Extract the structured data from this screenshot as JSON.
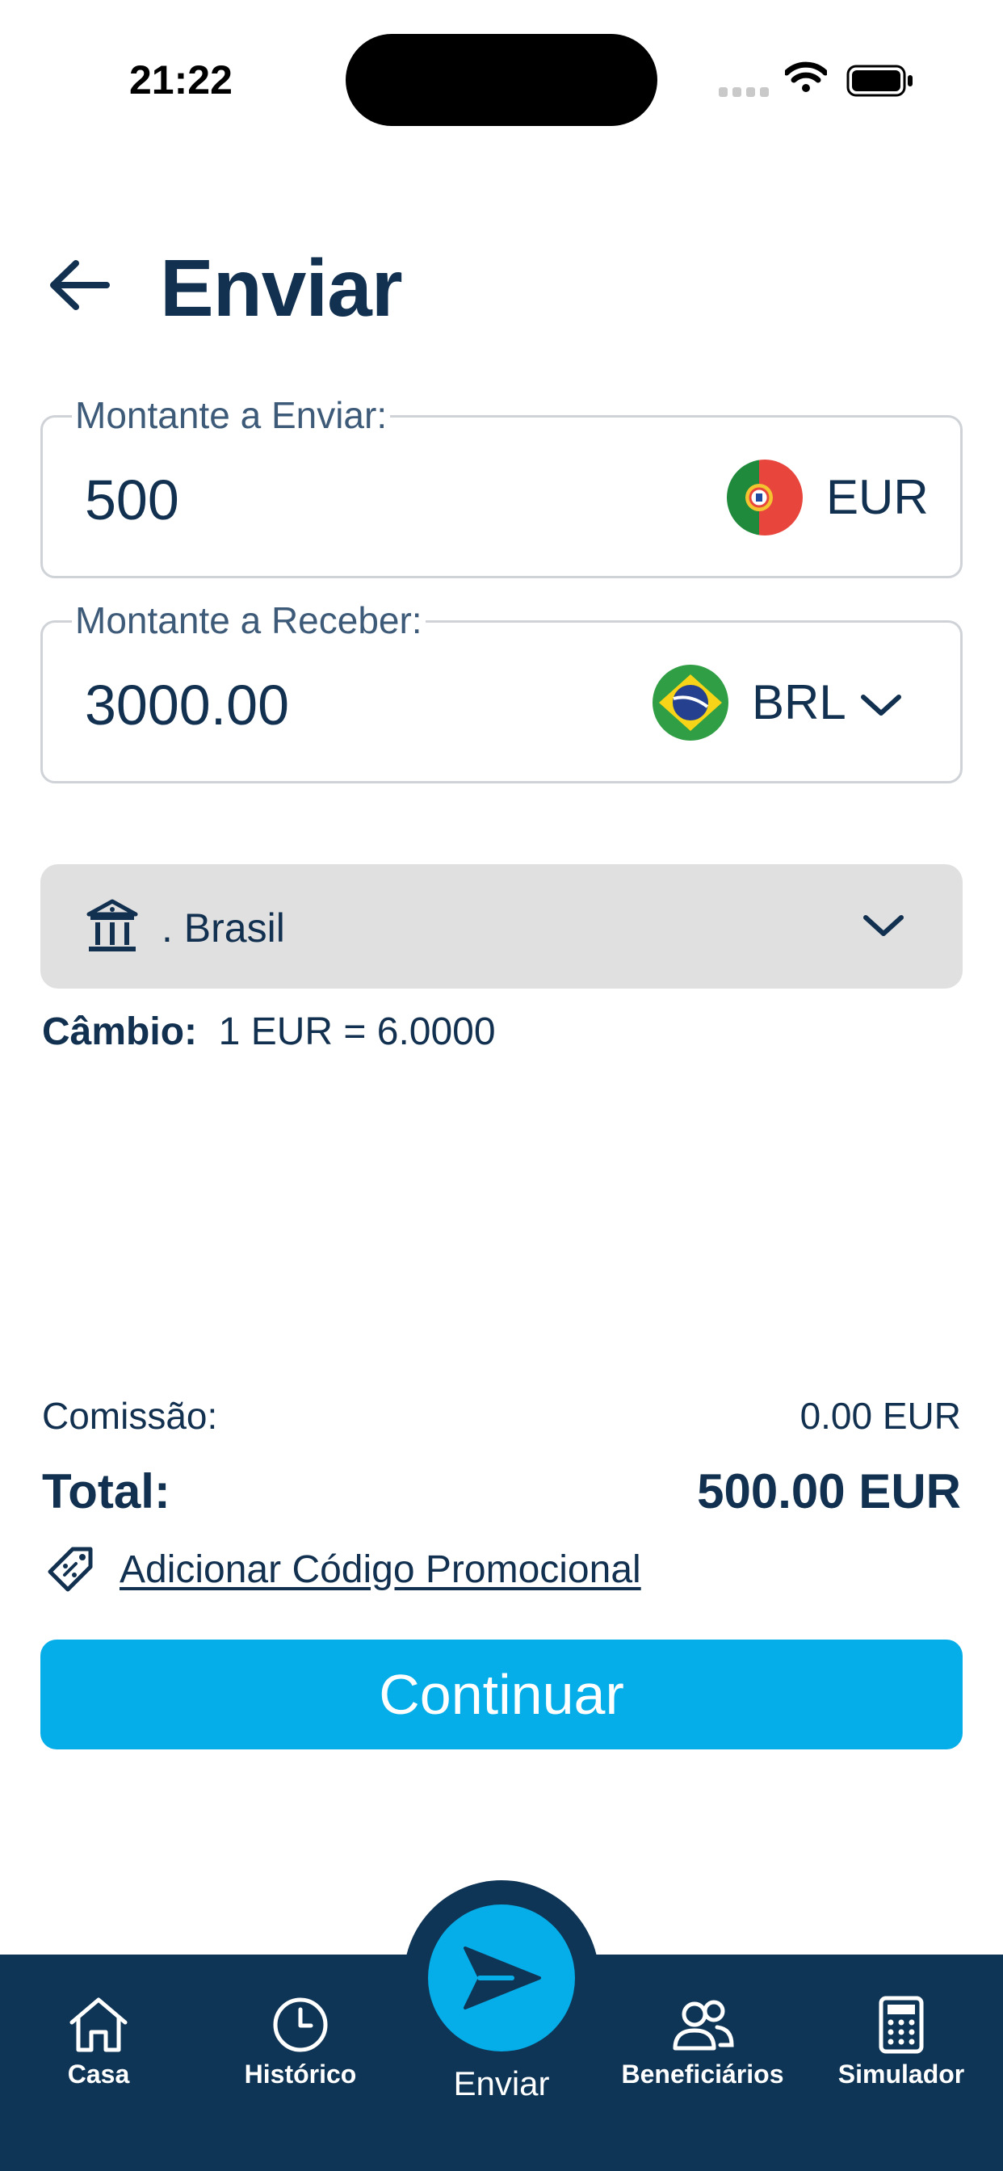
{
  "status_bar": {
    "time": "21:22"
  },
  "header": {
    "title": "Enviar",
    "back_icon": "arrow-left-icon"
  },
  "send_field": {
    "label": "Montante a Enviar:",
    "value": "500",
    "currency": "EUR",
    "flag": "portugal-flag-icon"
  },
  "receive_field": {
    "label": "Montante a Receber:",
    "value": "3000.00",
    "currency": "BRL",
    "flag": "brazil-flag-icon",
    "dropdown_icon": "chevron-down-icon"
  },
  "bank_select": {
    "label": ". Brasil",
    "icon": "bank-icon",
    "dropdown_icon": "chevron-down-icon"
  },
  "exchange": {
    "label": "Câmbio:",
    "value": "1 EUR = 6.0000"
  },
  "summary": {
    "fee_label": "Comissão:",
    "fee_value": "0.00 EUR",
    "total_label": "Total:",
    "total_value": "500.00 EUR"
  },
  "promo": {
    "label": "Adicionar Código Promocional",
    "icon": "discount-tag-icon"
  },
  "continue_button": {
    "label": "Continuar"
  },
  "colors": {
    "primary": "#05aee8",
    "navy": "#0f3556",
    "text": "#12304f",
    "field_border": "#cfd3d8",
    "select_bg": "#e0e0e0"
  },
  "tabbar": {
    "items": [
      {
        "label": "Casa",
        "icon": "home-icon"
      },
      {
        "label": "Histórico",
        "icon": "clock-icon"
      },
      {
        "label": "Enviar",
        "icon": "send-icon"
      },
      {
        "label": "Beneficiários",
        "icon": "users-icon"
      },
      {
        "label": "Simulador",
        "icon": "calculator-icon"
      }
    ]
  }
}
